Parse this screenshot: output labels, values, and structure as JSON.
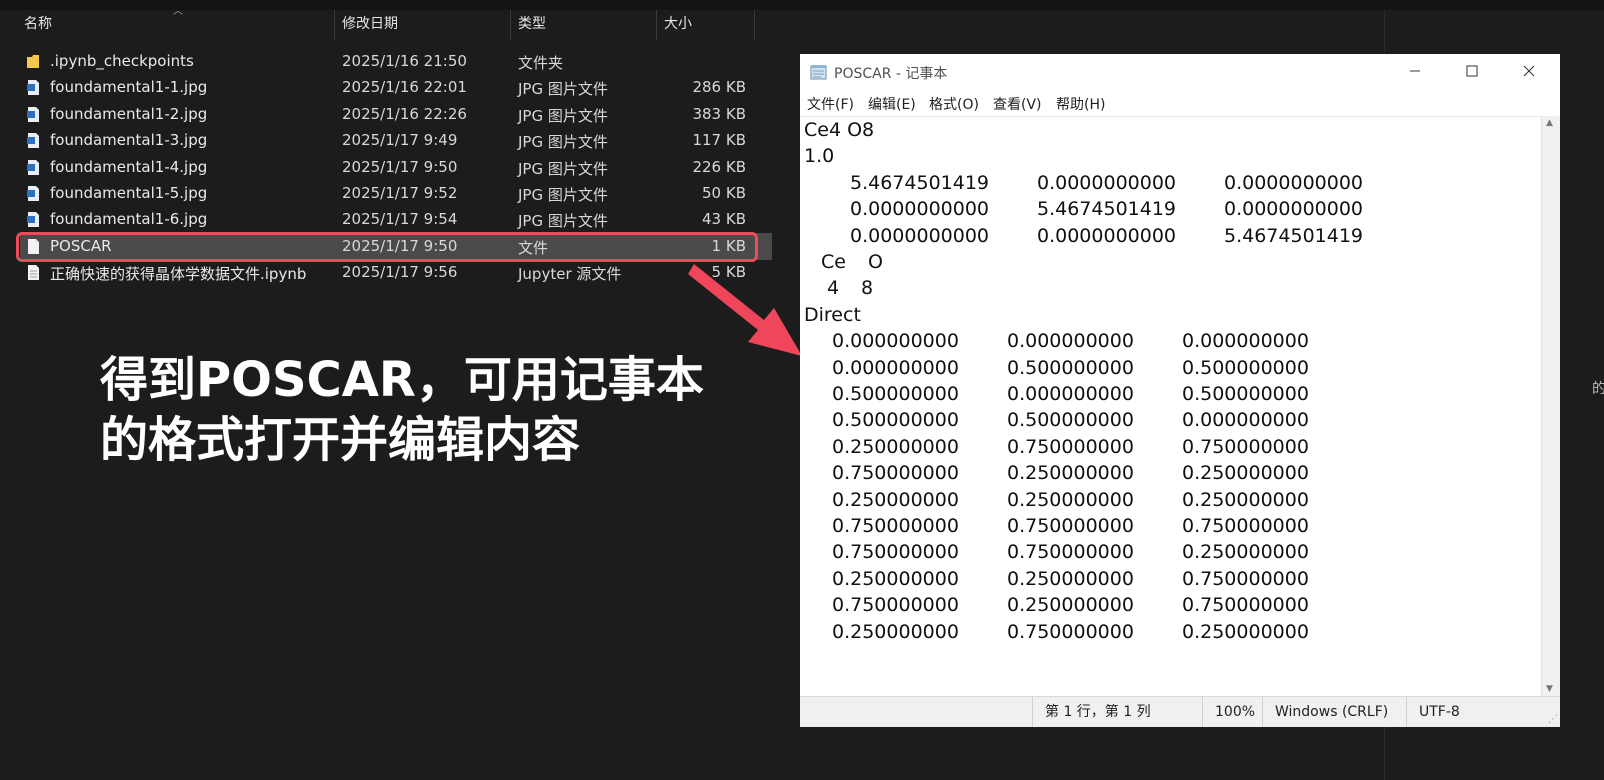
{
  "explorer": {
    "columns": {
      "name": "名称",
      "modified": "修改日期",
      "type": "类型",
      "size": "大小"
    },
    "files": [
      {
        "name": ".ipynb_checkpoints",
        "modified": "2025/1/16 21:50",
        "type": "文件夹",
        "size": "",
        "icon": "folder-icon"
      },
      {
        "name": "foundamental1-1.jpg",
        "modified": "2025/1/16 22:01",
        "type": "JPG 图片文件",
        "size": "286 KB",
        "icon": "image-file-icon"
      },
      {
        "name": "foundamental1-2.jpg",
        "modified": "2025/1/16 22:26",
        "type": "JPG 图片文件",
        "size": "383 KB",
        "icon": "image-file-icon"
      },
      {
        "name": "foundamental1-3.jpg",
        "modified": "2025/1/17 9:49",
        "type": "JPG 图片文件",
        "size": "117 KB",
        "icon": "image-file-icon"
      },
      {
        "name": "foundamental1-4.jpg",
        "modified": "2025/1/17 9:50",
        "type": "JPG 图片文件",
        "size": "226 KB",
        "icon": "image-file-icon"
      },
      {
        "name": "foundamental1-5.jpg",
        "modified": "2025/1/17 9:52",
        "type": "JPG 图片文件",
        "size": "50 KB",
        "icon": "image-file-icon"
      },
      {
        "name": "foundamental1-6.jpg",
        "modified": "2025/1/17 9:54",
        "type": "JPG 图片文件",
        "size": "43 KB",
        "icon": "image-file-icon"
      },
      {
        "name": "POSCAR",
        "modified": "2025/1/17 9:50",
        "type": "文件",
        "size": "1 KB",
        "icon": "blank-file-icon"
      },
      {
        "name": "正确快速的获得晶体学数据文件.ipynb",
        "modified": "2025/1/17 9:56",
        "type": "Jupyter 源文件",
        "size": "5 KB",
        "icon": "text-file-icon"
      }
    ],
    "edge_char": "的"
  },
  "annotation": {
    "line1": "得到POSCAR，可用记事本",
    "line2": "的格式打开并编辑内容"
  },
  "notepad": {
    "title": "POSCAR - 记事本",
    "menu": [
      "文件(F)",
      "编辑(E)",
      "格式(O)",
      "查看(V)",
      "帮助(H)"
    ],
    "content": {
      "comment": "Ce4 O8",
      "scale": "1.0",
      "lattice": [
        [
          "5.4674501419",
          "0.0000000000",
          "0.0000000000"
        ],
        [
          "0.0000000000",
          "5.4674501419",
          "0.0000000000"
        ],
        [
          "0.0000000000",
          "0.0000000000",
          "5.4674501419"
        ]
      ],
      "elements": [
        "Ce",
        "O"
      ],
      "counts": [
        "4",
        "8"
      ],
      "coord_type": "Direct",
      "positions": [
        [
          "0.000000000",
          "0.000000000",
          "0.000000000"
        ],
        [
          "0.000000000",
          "0.500000000",
          "0.500000000"
        ],
        [
          "0.500000000",
          "0.000000000",
          "0.500000000"
        ],
        [
          "0.500000000",
          "0.500000000",
          "0.000000000"
        ],
        [
          "0.250000000",
          "0.750000000",
          "0.750000000"
        ],
        [
          "0.750000000",
          "0.250000000",
          "0.250000000"
        ],
        [
          "0.250000000",
          "0.250000000",
          "0.250000000"
        ],
        [
          "0.750000000",
          "0.750000000",
          "0.750000000"
        ],
        [
          "0.750000000",
          "0.750000000",
          "0.250000000"
        ],
        [
          "0.250000000",
          "0.250000000",
          "0.750000000"
        ],
        [
          "0.750000000",
          "0.250000000",
          "0.750000000"
        ],
        [
          "0.250000000",
          "0.750000000",
          "0.250000000"
        ]
      ]
    },
    "status": {
      "position": "第 1 行，第 1 列",
      "zoom": "100%",
      "line_ending": "Windows (CRLF)",
      "encoding": "UTF-8"
    }
  },
  "colors": {
    "highlight": "#ee4a5c",
    "arrow": "#f0465c",
    "background": "#1c1c1c",
    "selected_row": "#4a4a4a"
  }
}
